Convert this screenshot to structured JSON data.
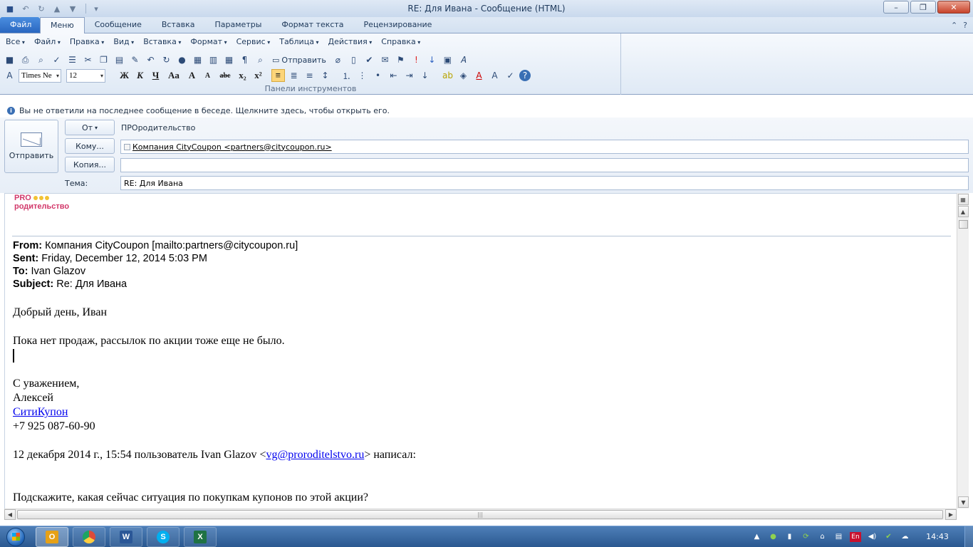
{
  "window": {
    "title": "RE: Для Ивана  -  Сообщение (HTML)",
    "controls": [
      "–",
      "❐",
      "✕"
    ]
  },
  "ribbon_tabs": [
    {
      "label": "Файл"
    },
    {
      "label": "Меню"
    },
    {
      "label": "Сообщение"
    },
    {
      "label": "Вставка"
    },
    {
      "label": "Параметры"
    },
    {
      "label": "Формат текста"
    },
    {
      "label": "Рецензирование"
    }
  ],
  "menus": [
    "Все",
    "Файл",
    "Правка",
    "Вид",
    "Вставка",
    "Формат",
    "Сервис",
    "Таблица",
    "Действия",
    "Справка"
  ],
  "toolbar": {
    "send_label": "Отправить",
    "font_name": "Times Ne",
    "font_size": "12",
    "bold": "Ж",
    "italic": "К",
    "underline": "Ч",
    "change_case": "Aa",
    "grow_font": "A",
    "shrink_font": "A",
    "strike": "abc",
    "subscript": "x₂",
    "superscript": "x²",
    "group_label": "Панели инструментов"
  },
  "infobar": {
    "text": "Вы не ответили на последнее сообщение в беседе. Щелкните здесь, чтобы открыть его."
  },
  "compose": {
    "send_button": "Отправить",
    "from_button": "От",
    "from_value": "ПРОродительство",
    "to_button": "Кому...",
    "to_value": "Компания CityCoupon <partners@citycoupon.ru>",
    "cc_button": "Копия...",
    "cc_value": "",
    "subject_label": "Тема:",
    "subject_value": "RE: Для Ивана"
  },
  "logo": {
    "top": "PRO",
    "bottom": "родительство"
  },
  "message": {
    "from_label": "From:",
    "from_value": "Компания CityCoupon [mailto:partners@citycoupon.ru]",
    "sent_label": "Sent:",
    "sent_value": "Friday, December 12, 2014 5:03 PM",
    "to_label": "To:",
    "to_value": "Ivan Glazov",
    "subject_label": "Subject:",
    "subject_value": "Re: Для Ивана",
    "greeting": "Добрый день, Иван",
    "line1": "Пока нет продаж, рассылок по акции тоже еще не было.",
    "regards": "С уважением,",
    "name": "Алексей",
    "company_link": "СитиКупон",
    "phone": "+7 925 087-60-90",
    "quote_prefix": "12 декабря 2014 г., 15:54 пользователь Ivan Glazov <",
    "quote_email": "vg@proroditelstvo.ru",
    "quote_suffix": "> написал:",
    "question": "Подскажите, какая сейчас ситуация по покупкам купонов по этой акции?"
  },
  "taskbar": {
    "apps": [
      {
        "name": "Outlook",
        "letter": "O",
        "color": "#e6a117"
      },
      {
        "name": "Chrome",
        "letter": "",
        "color": "#dd4b39"
      },
      {
        "name": "Word",
        "letter": "W",
        "color": "#2b5797"
      },
      {
        "name": "Skype",
        "letter": "S",
        "color": "#00aff0"
      },
      {
        "name": "Excel",
        "letter": "X",
        "color": "#1f7244"
      }
    ],
    "lang": "En",
    "time": "14:43"
  }
}
